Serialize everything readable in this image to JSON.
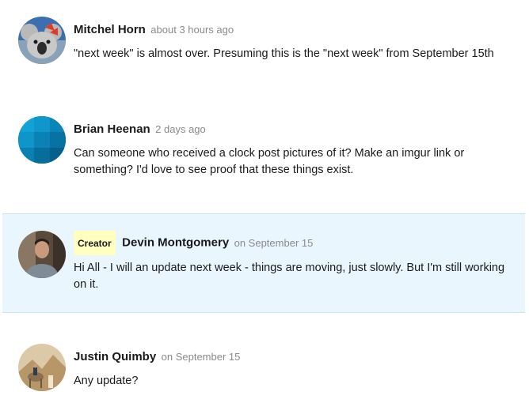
{
  "comments": [
    {
      "author": "Mitchel Horn",
      "time": "about 3 hours ago",
      "text": "\"next week\" is almost over. Presuming this is the \"next week\" from September 15th",
      "is_creator": false
    },
    {
      "author": "Brian Heenan",
      "time": "2 days ago",
      "text": "Can someone who received a clock post pictures of it? Make an imgur link or something? I'd love to see proof that these things exist.",
      "is_creator": false
    },
    {
      "author": "Devin Montgomery",
      "time": "on September 15",
      "badge": "Creator",
      "text": "Hi All - I will an update next week - things are moving, just slowly. But I'm still working on it.",
      "is_creator": true
    },
    {
      "author": "Justin Quimby",
      "time": "on September 15",
      "text": "Any update?",
      "is_creator": false
    }
  ],
  "colors": {
    "creator_bg": "#eaf6fd",
    "creator_badge_bg": "#ffffc0",
    "timestamp": "#8a8a8a"
  }
}
